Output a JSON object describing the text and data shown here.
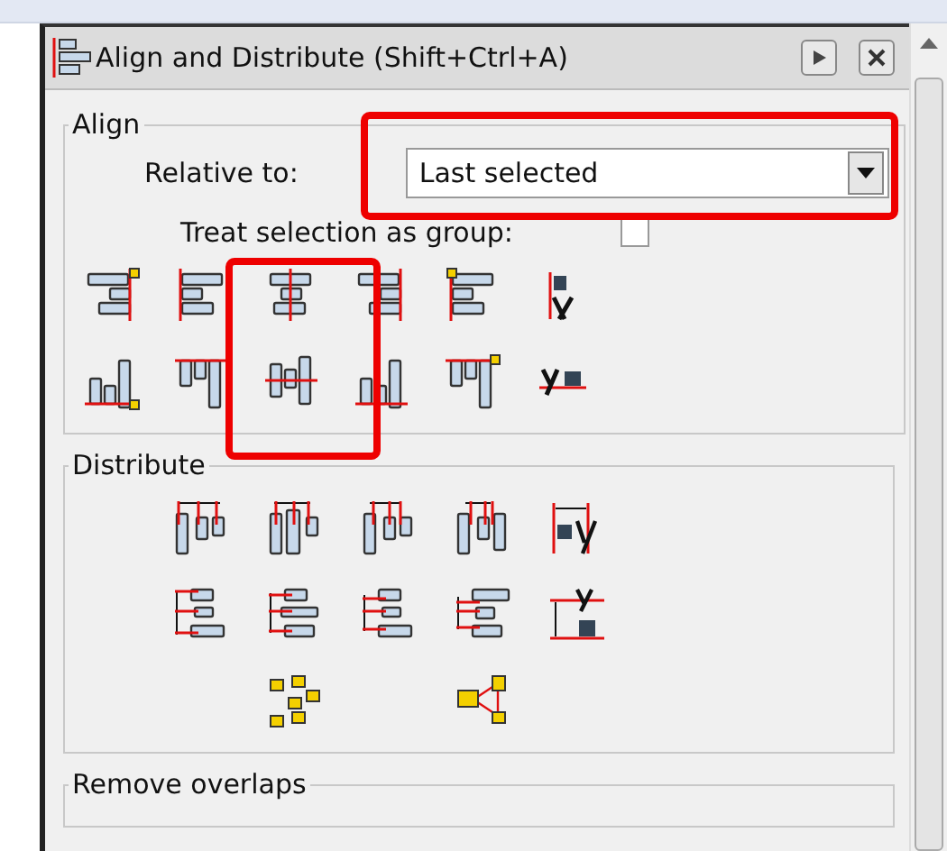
{
  "window": {
    "title": "Align and Distribute (Shift+Ctrl+A)"
  },
  "align": {
    "legend": "Align",
    "relative_to": {
      "label": "Relative to:",
      "value": "Last selected"
    },
    "treat_as_group": {
      "label": "Treat selection as group:",
      "checked": false
    }
  },
  "distribute": {
    "legend": "Distribute"
  },
  "remove_overlaps": {
    "legend": "Remove overlaps"
  }
}
